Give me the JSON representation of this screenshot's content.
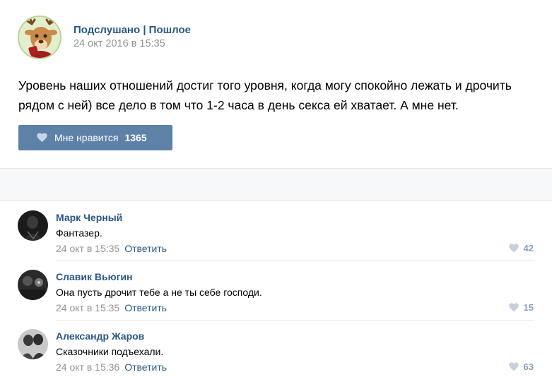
{
  "post": {
    "author": "Подслушано | Пошлое",
    "date": "24 окт 2016 в 15:35",
    "text": "Уровень наших отношений достиг того уровня, когда могу спокойно лежать и дрочить рядом с ней) все дело в том что 1-2 часа в день секса ей хватает. А мне нет.",
    "like_label": "Мне нравится",
    "like_count": "1365"
  },
  "colors": {
    "link": "#2a5885",
    "button": "#5e81a8",
    "muted": "#939393"
  },
  "comments": [
    {
      "name": "Марк Черный",
      "text": "Фантазер.",
      "time": "24 окт в 15:35",
      "reply": "Ответить",
      "likes": "42"
    },
    {
      "name": "Славик Вьюгин",
      "text": "Она пусть дрочит тебе а не ты себе господи.",
      "time": "24 окт в 15:35",
      "reply": "Ответить",
      "likes": "15"
    },
    {
      "name": "Александр Жаров",
      "text": "Сказочники подъехали.",
      "time": "24 окт в 15:36",
      "reply": "Ответить",
      "likes": "63"
    }
  ]
}
